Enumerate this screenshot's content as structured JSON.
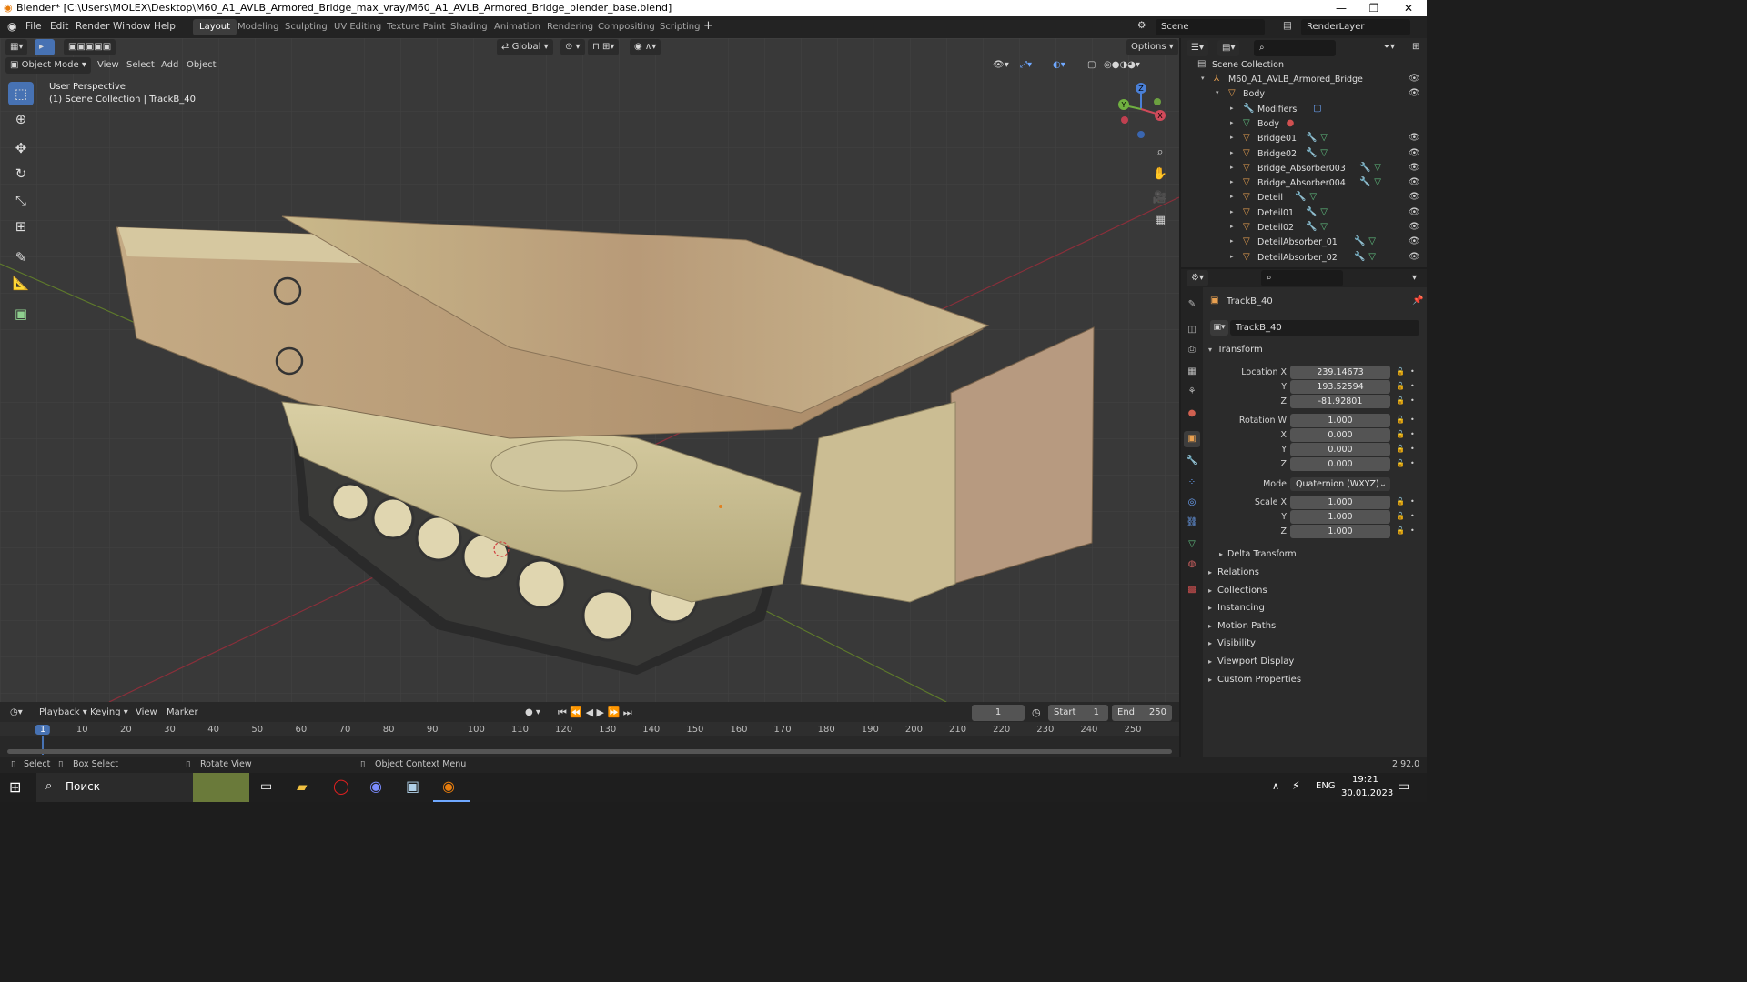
{
  "window": {
    "title": "Blender* [C:\\Users\\MOLEX\\Desktop\\M60_A1_AVLB_Armored_Bridge_max_vray/M60_A1_AVLB_Armored_Bridge_blender_base.blend]",
    "min": "—",
    "max": "❐",
    "close": "✕"
  },
  "menu": {
    "file": "File",
    "edit": "Edit",
    "render": "Render",
    "window": "Window",
    "help": "Help"
  },
  "workspaces": [
    "Layout",
    "Modeling",
    "Sculpting",
    "UV Editing",
    "Texture Paint",
    "Shading",
    "Animation",
    "Rendering",
    "Compositing",
    "Scripting"
  ],
  "workspace_add": "+",
  "scene": {
    "name": "Scene",
    "render_layer": "RenderLayer"
  },
  "viewport": {
    "mode": "Object Mode",
    "menu_view": "View",
    "menu_select": "Select",
    "menu_add": "Add",
    "menu_object": "Object",
    "orientation": "Global",
    "options": "Options",
    "perspective": "User Perspective",
    "collection_info": "(1) Scene Collection | TrackB_40",
    "gizmo": {
      "x": "X",
      "y": "Y",
      "z": "Z"
    }
  },
  "outliner": {
    "root": "Scene Collection",
    "rows": [
      {
        "name": "M60_A1_AVLB_Armored_Bridge",
        "indent": 0
      },
      {
        "name": "Body",
        "indent": 1
      },
      {
        "name": "Modifiers",
        "indent": 2
      },
      {
        "name": "Body",
        "indent": 2
      },
      {
        "name": "Bridge01",
        "indent": 2
      },
      {
        "name": "Bridge02",
        "indent": 2
      },
      {
        "name": "Bridge_Absorber003",
        "indent": 2
      },
      {
        "name": "Bridge_Absorber004",
        "indent": 2
      },
      {
        "name": "Deteil",
        "indent": 2
      },
      {
        "name": "Deteil01",
        "indent": 2
      },
      {
        "name": "Deteil02",
        "indent": 2
      },
      {
        "name": "DeteilAbsorber_01",
        "indent": 2
      },
      {
        "name": "DeteilAbsorber_02",
        "indent": 2
      }
    ]
  },
  "properties": {
    "object_name": "TrackB_40",
    "object_field": "TrackB_40",
    "transform_label": "Transform",
    "location_label": "Location X",
    "location": {
      "x": "239.14673",
      "y": "193.52594",
      "z": "-81.92801"
    },
    "rotation_label": "Rotation W",
    "rotation": {
      "w": "1.000",
      "x": "0.000",
      "y": "0.000",
      "z": "0.000"
    },
    "mode_label": "Mode",
    "mode_value": "Quaternion (WXYZ)",
    "scale_label": "Scale X",
    "scale": {
      "x": "1.000",
      "y": "1.000",
      "z": "1.000"
    },
    "axis_y": "Y",
    "axis_z": "Z",
    "axis_x": "X",
    "delta": "Delta Transform",
    "sections": [
      "Relations",
      "Collections",
      "Instancing",
      "Motion Paths",
      "Visibility",
      "Viewport Display",
      "Custom Properties"
    ]
  },
  "timeline": {
    "playback": "Playback",
    "keying": "Keying",
    "view": "View",
    "marker": "Marker",
    "current_frame": "1",
    "start_label": "Start",
    "start": "1",
    "end_label": "End",
    "end": "250",
    "ticks": [
      "1",
      "10",
      "20",
      "30",
      "40",
      "50",
      "60",
      "70",
      "80",
      "90",
      "100",
      "110",
      "120",
      "130",
      "140",
      "150",
      "160",
      "170",
      "180",
      "190",
      "200",
      "210",
      "220",
      "230",
      "240",
      "250"
    ]
  },
  "status": {
    "select": "Select",
    "box_select": "Box Select",
    "rotate_view": "Rotate View",
    "context_menu": "Object Context Menu",
    "version": "2.92.0"
  },
  "taskbar": {
    "search": "Поиск",
    "lang": "ENG",
    "time": "19:21",
    "date": "30.01.2023"
  }
}
